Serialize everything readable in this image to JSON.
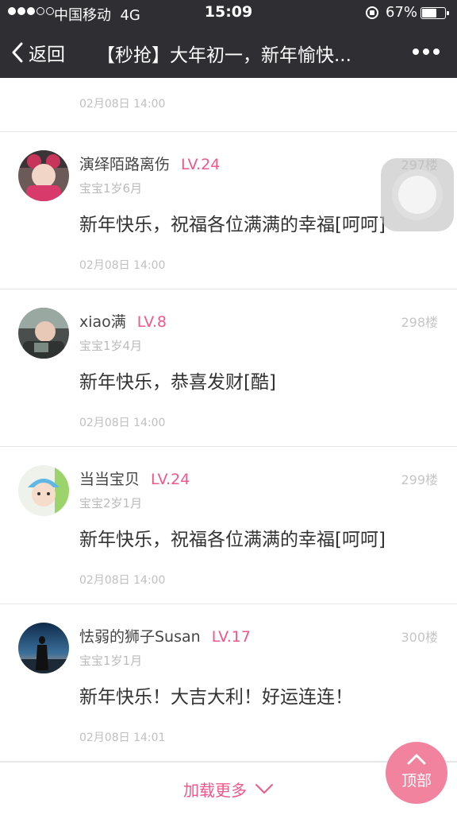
{
  "status_bar": {
    "carrier": "中国移动",
    "network": "4G",
    "time": "15:09",
    "battery_percent": "67%",
    "battery_level": 0.67,
    "signal_bars_filled": 3,
    "signal_bars_total": 5
  },
  "nav": {
    "back_label": "返回",
    "title": "【秒抢】大年初一，新年愉快..."
  },
  "first_row": {
    "timestamp": "02月08日 14:00"
  },
  "posts": [
    {
      "username": "演绎陌路离伤",
      "level": "LV.24",
      "floor": "297楼",
      "baby_age": "宝宝1岁6月",
      "content": "新年快乐，祝福各位满满的幸福[呵呵]",
      "timestamp": "02月08日 14:00"
    },
    {
      "username": "xiao满",
      "level": "LV.8",
      "floor": "298楼",
      "baby_age": "宝宝1岁4月",
      "content": "新年快乐，恭喜发财[酷]",
      "timestamp": "02月08日 14:00"
    },
    {
      "username": "当当宝贝",
      "level": "LV.24",
      "floor": "299楼",
      "baby_age": "宝宝2岁1月",
      "content": "新年快乐，祝福各位满满的幸福[呵呵]",
      "timestamp": "02月08日 14:00"
    },
    {
      "username": "怯弱的狮子Susan",
      "level": "LV.17",
      "floor": "300楼",
      "baby_age": "宝宝1岁1月",
      "content": "新年快乐！大吉大利！好运连连！",
      "timestamp": "02月08日 14:01"
    }
  ],
  "load_more": "加载更多",
  "top_button": "顶部",
  "colors": {
    "accent_pink": "#f0578a",
    "nav_bg": "#2e2e33",
    "top_button_bg": "#f2839f"
  }
}
